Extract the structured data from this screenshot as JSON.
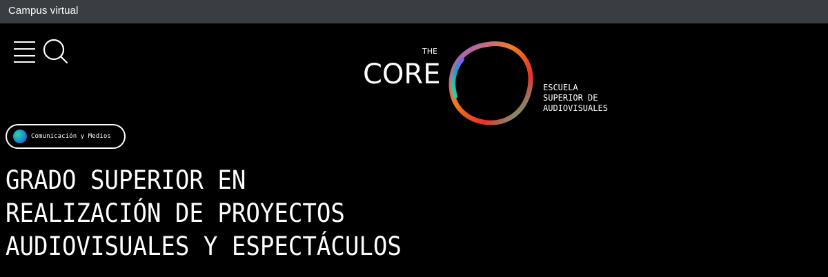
{
  "topbar": {
    "campus_link": "Campus virtual",
    "background": "#3a3d42"
  },
  "header": {
    "menu_icon": "hamburger-menu-icon",
    "search_icon": "search-icon",
    "logo": {
      "the": "THE",
      "core": "CORE",
      "subtitle": [
        "ESCUELA",
        "SUPERIOR DE",
        "AUDIOVISUALES"
      ],
      "ring_colors": [
        "#8a5cf6",
        "#f07c1e",
        "#e8322a",
        "#2fd3a0"
      ]
    }
  },
  "category": {
    "label": "Comunicación y Medios",
    "icon": "gradient-dot-icon"
  },
  "title": {
    "lines": [
      "GRADO SUPERIOR EN",
      "REALIZACIÓN DE PROYECTOS",
      "AUDIOVISUALES Y ESPECTÁCULOS"
    ]
  }
}
